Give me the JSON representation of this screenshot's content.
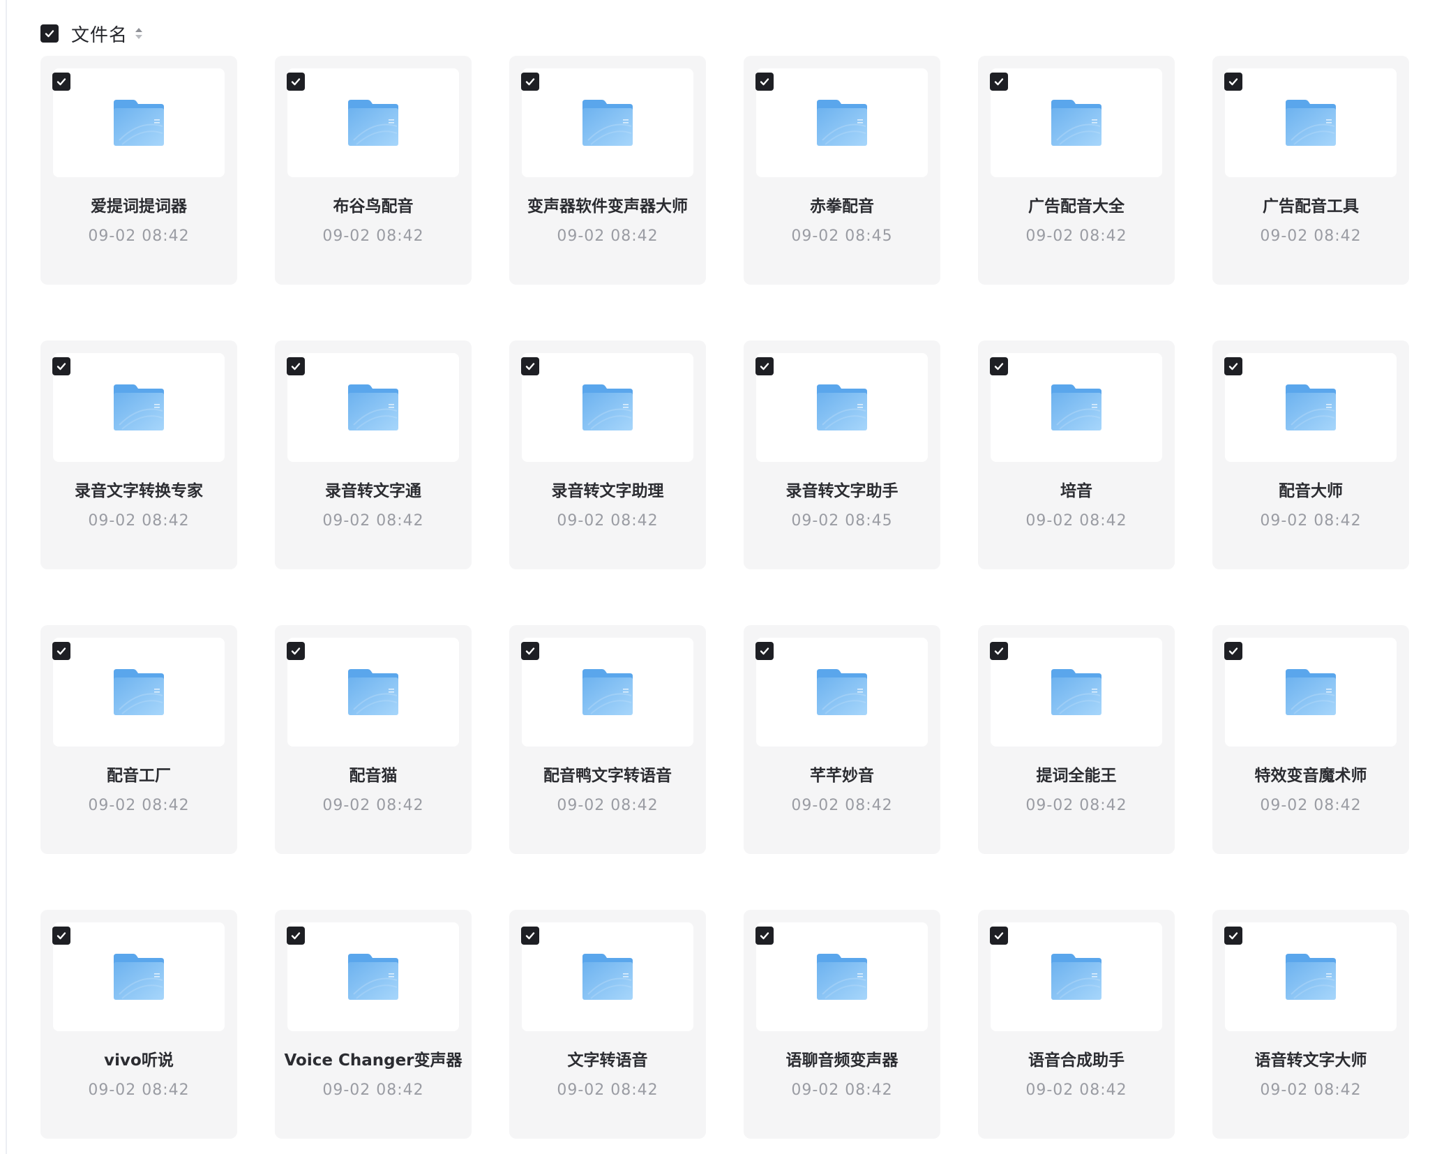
{
  "header": {
    "select_all_checked": true,
    "column_label": "文件名",
    "sort_icon": "sort-up-down-icon"
  },
  "colors": {
    "checkbox": "#1e1f24",
    "card_bg": "#f5f5f6",
    "folder_blue": "#7fbff3",
    "time_text": "#9a9ca3"
  },
  "files": [
    {
      "name": "爱提词提词器",
      "time": "09-02 08:42",
      "checked": true,
      "icon": "folder-icon"
    },
    {
      "name": "布谷鸟配音",
      "time": "09-02 08:42",
      "checked": true,
      "icon": "folder-icon"
    },
    {
      "name": "变声器软件变声器大师",
      "time": "09-02 08:42",
      "checked": true,
      "icon": "folder-icon"
    },
    {
      "name": "赤拳配音",
      "time": "09-02 08:45",
      "checked": true,
      "icon": "folder-icon"
    },
    {
      "name": "广告配音大全",
      "time": "09-02 08:42",
      "checked": true,
      "icon": "folder-icon"
    },
    {
      "name": "广告配音工具",
      "time": "09-02 08:42",
      "checked": true,
      "icon": "folder-icon"
    },
    {
      "name": "录音文字转换专家",
      "time": "09-02 08:42",
      "checked": true,
      "icon": "folder-icon"
    },
    {
      "name": "录音转文字通",
      "time": "09-02 08:42",
      "checked": true,
      "icon": "folder-icon"
    },
    {
      "name": "录音转文字助理",
      "time": "09-02 08:42",
      "checked": true,
      "icon": "folder-icon"
    },
    {
      "name": "录音转文字助手",
      "time": "09-02 08:45",
      "checked": true,
      "icon": "folder-icon"
    },
    {
      "name": "培音",
      "time": "09-02 08:42",
      "checked": true,
      "icon": "folder-icon"
    },
    {
      "name": "配音大师",
      "time": "09-02 08:42",
      "checked": true,
      "icon": "folder-icon"
    },
    {
      "name": "配音工厂",
      "time": "09-02 08:42",
      "checked": true,
      "icon": "folder-icon"
    },
    {
      "name": "配音猫",
      "time": "09-02 08:42",
      "checked": true,
      "icon": "folder-icon"
    },
    {
      "name": "配音鸭文字转语音",
      "time": "09-02 08:42",
      "checked": true,
      "icon": "folder-icon"
    },
    {
      "name": "芊芊妙音",
      "time": "09-02 08:42",
      "checked": true,
      "icon": "folder-icon"
    },
    {
      "name": "提词全能王",
      "time": "09-02 08:42",
      "checked": true,
      "icon": "folder-icon"
    },
    {
      "name": "特效变音魔术师",
      "time": "09-02 08:42",
      "checked": true,
      "icon": "folder-icon"
    },
    {
      "name": "vivo听说",
      "time": "09-02 08:42",
      "checked": true,
      "icon": "folder-icon"
    },
    {
      "name": "Voice Changer变声器",
      "time": "09-02 08:42",
      "checked": true,
      "icon": "folder-icon"
    },
    {
      "name": "文字转语音",
      "time": "09-02 08:42",
      "checked": true,
      "icon": "folder-icon"
    },
    {
      "name": "语聊音频变声器",
      "time": "09-02 08:42",
      "checked": true,
      "icon": "folder-icon"
    },
    {
      "name": "语音合成助手",
      "time": "09-02 08:42",
      "checked": true,
      "icon": "folder-icon"
    },
    {
      "name": "语音转文字大师",
      "time": "09-02 08:42",
      "checked": true,
      "icon": "folder-icon"
    }
  ]
}
